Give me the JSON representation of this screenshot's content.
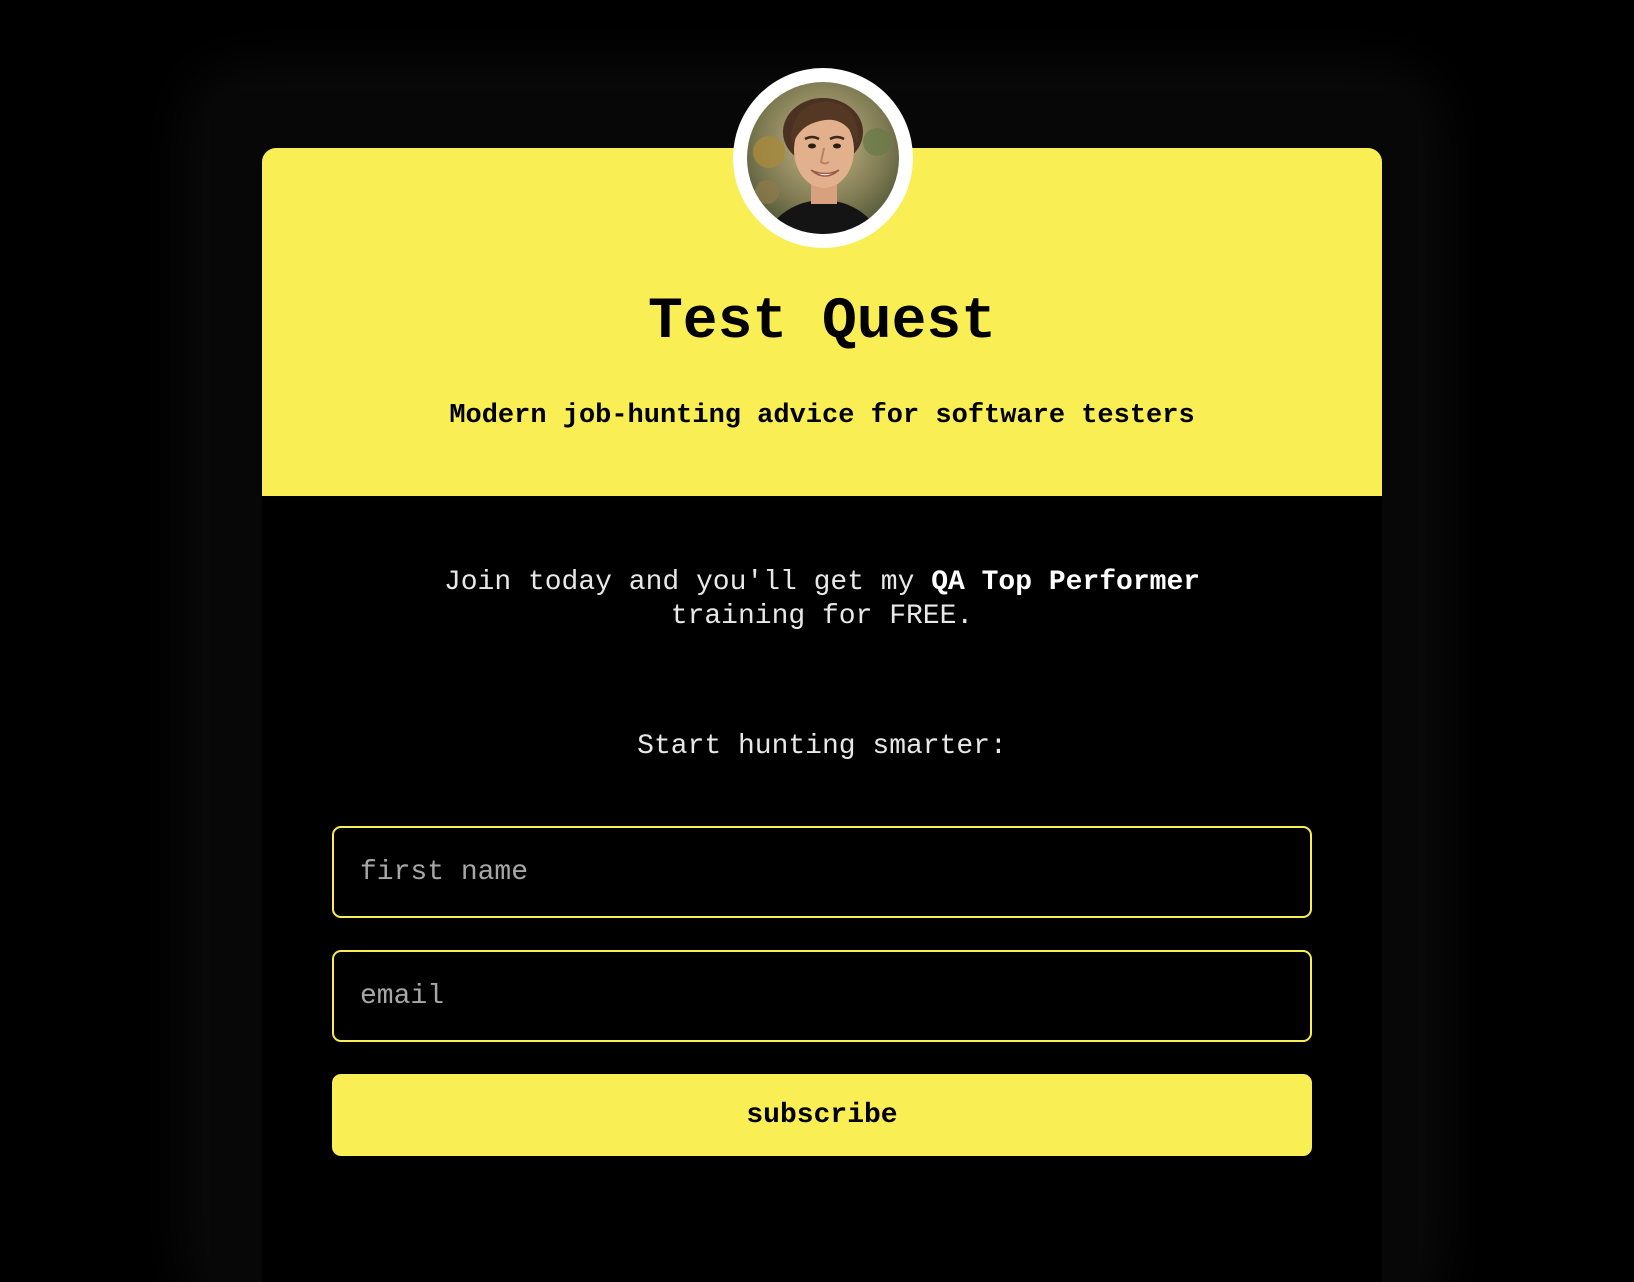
{
  "colors": {
    "accent": "#f9ee54",
    "background": "#000000",
    "text_light": "#e8e8e8",
    "placeholder": "#a7a7a7"
  },
  "header": {
    "avatar_icon": "profile-photo",
    "title": "Test Quest",
    "subtitle": "Modern job-hunting advice for software testers"
  },
  "intro": {
    "lead": "Join today and you'll get my ",
    "highlight": "QA Top Performer",
    "tail": " training for FREE."
  },
  "form": {
    "cta_label": "Start hunting smarter:",
    "first_name_placeholder": "first name",
    "email_placeholder": "email",
    "subscribe_label": "subscribe"
  }
}
